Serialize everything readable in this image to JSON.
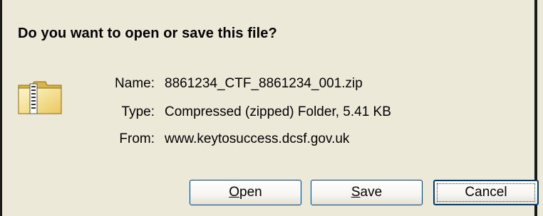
{
  "dialog": {
    "question": "Do you want to open or save this file?"
  },
  "file": {
    "icon": "zip-folder-icon",
    "name_label": "Name:",
    "name_value": "8861234_CTF_8861234_001.zip",
    "type_label": "Type:",
    "type_value": "Compressed (zipped) Folder, 5.41 KB",
    "from_label": "From:",
    "from_value": "www.keytosuccess.dcsf.gov.uk"
  },
  "buttons": {
    "open_mnemonic": "O",
    "open_rest": "pen",
    "save_mnemonic": "S",
    "save_rest": "ave",
    "cancel_label": "Cancel"
  }
}
